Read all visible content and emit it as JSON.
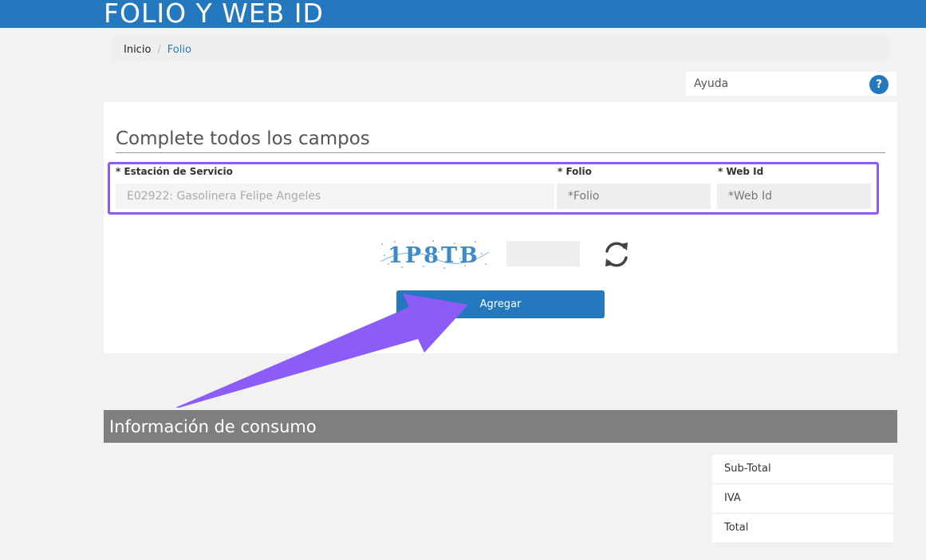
{
  "header": {
    "title": "FOLIO Y WEB ID"
  },
  "breadcrumb": {
    "home": "Inicio",
    "separator": "/",
    "current": "Folio"
  },
  "help": {
    "label": "Ayuda",
    "icon": "?"
  },
  "form": {
    "heading": "Complete todos los campos",
    "station": {
      "label": "* Estación de Servicio",
      "value": "E02922: Gasolinera Felipe Angeles"
    },
    "folio": {
      "label": "* Folio",
      "placeholder": "*Folio"
    },
    "webid": {
      "label": "* Web Id",
      "placeholder": "*Web Id"
    },
    "captcha_text": "1P8TB",
    "submit_label": "Agregar"
  },
  "consumo": {
    "title": "Información de consumo",
    "rows": [
      "Sub-Total",
      "IVA",
      "Total"
    ]
  },
  "colors": {
    "brand": "#2479be",
    "highlight": "#8b5cf6",
    "section_bar": "#7f7f7f"
  }
}
